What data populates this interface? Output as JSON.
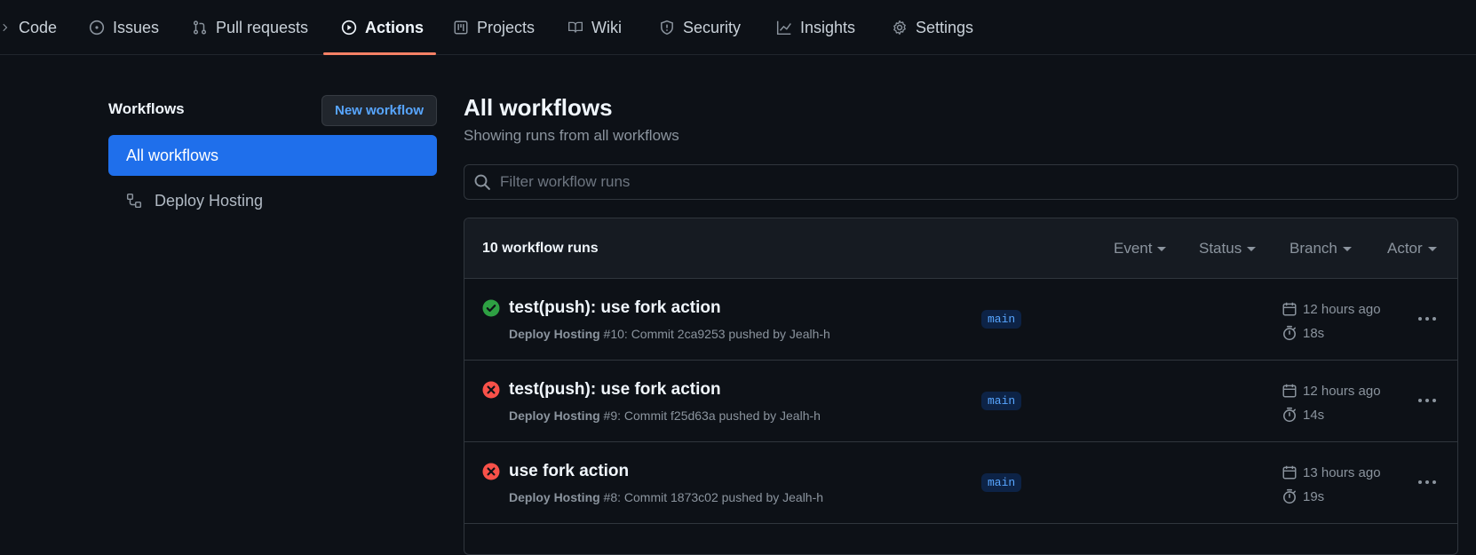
{
  "nav": {
    "tabs": [
      {
        "label": "Code",
        "icon": "chevron-right-icon"
      },
      {
        "label": "Issues",
        "icon": "issue-icon"
      },
      {
        "label": "Pull requests",
        "icon": "pull-request-icon"
      },
      {
        "label": "Actions",
        "icon": "play-icon",
        "active": true
      },
      {
        "label": "Projects",
        "icon": "project-icon"
      },
      {
        "label": "Wiki",
        "icon": "book-icon"
      },
      {
        "label": "Security",
        "icon": "shield-icon"
      },
      {
        "label": "Insights",
        "icon": "graph-icon"
      },
      {
        "label": "Settings",
        "icon": "gear-icon"
      }
    ],
    "active_color": "#f78166"
  },
  "sidebar": {
    "title": "Workflows",
    "new_button": "New workflow",
    "items": [
      {
        "label": "All workflows",
        "selected": true
      },
      {
        "label": "Deploy Hosting",
        "icon": "workflow-icon"
      }
    ]
  },
  "main": {
    "title": "All workflows",
    "subtitle": "Showing runs from all workflows",
    "filter_placeholder": "Filter workflow runs"
  },
  "runs": {
    "count_label": "10 workflow runs",
    "filters": [
      "Event",
      "Status",
      "Branch",
      "Actor"
    ],
    "items": [
      {
        "status": "success",
        "title": "test(push): use fork action",
        "workflow": "Deploy Hosting",
        "meta": " #10: Commit 2ca9253 pushed by Jealh-h",
        "branch": "main",
        "time": "12 hours ago",
        "duration": "18s"
      },
      {
        "status": "failure",
        "title": "test(push): use fork action",
        "workflow": "Deploy Hosting",
        "meta": " #9: Commit f25d63a pushed by Jealh-h",
        "branch": "main",
        "time": "12 hours ago",
        "duration": "14s"
      },
      {
        "status": "failure",
        "title": "use fork action",
        "workflow": "Deploy Hosting",
        "meta": " #8: Commit 1873c02 pushed by Jealh-h",
        "branch": "main",
        "time": "13 hours ago",
        "duration": "19s"
      }
    ]
  },
  "colors": {
    "success": "#2ea043",
    "failure": "#f85149",
    "accent": "#1f6feb",
    "background": "#0d1117"
  }
}
